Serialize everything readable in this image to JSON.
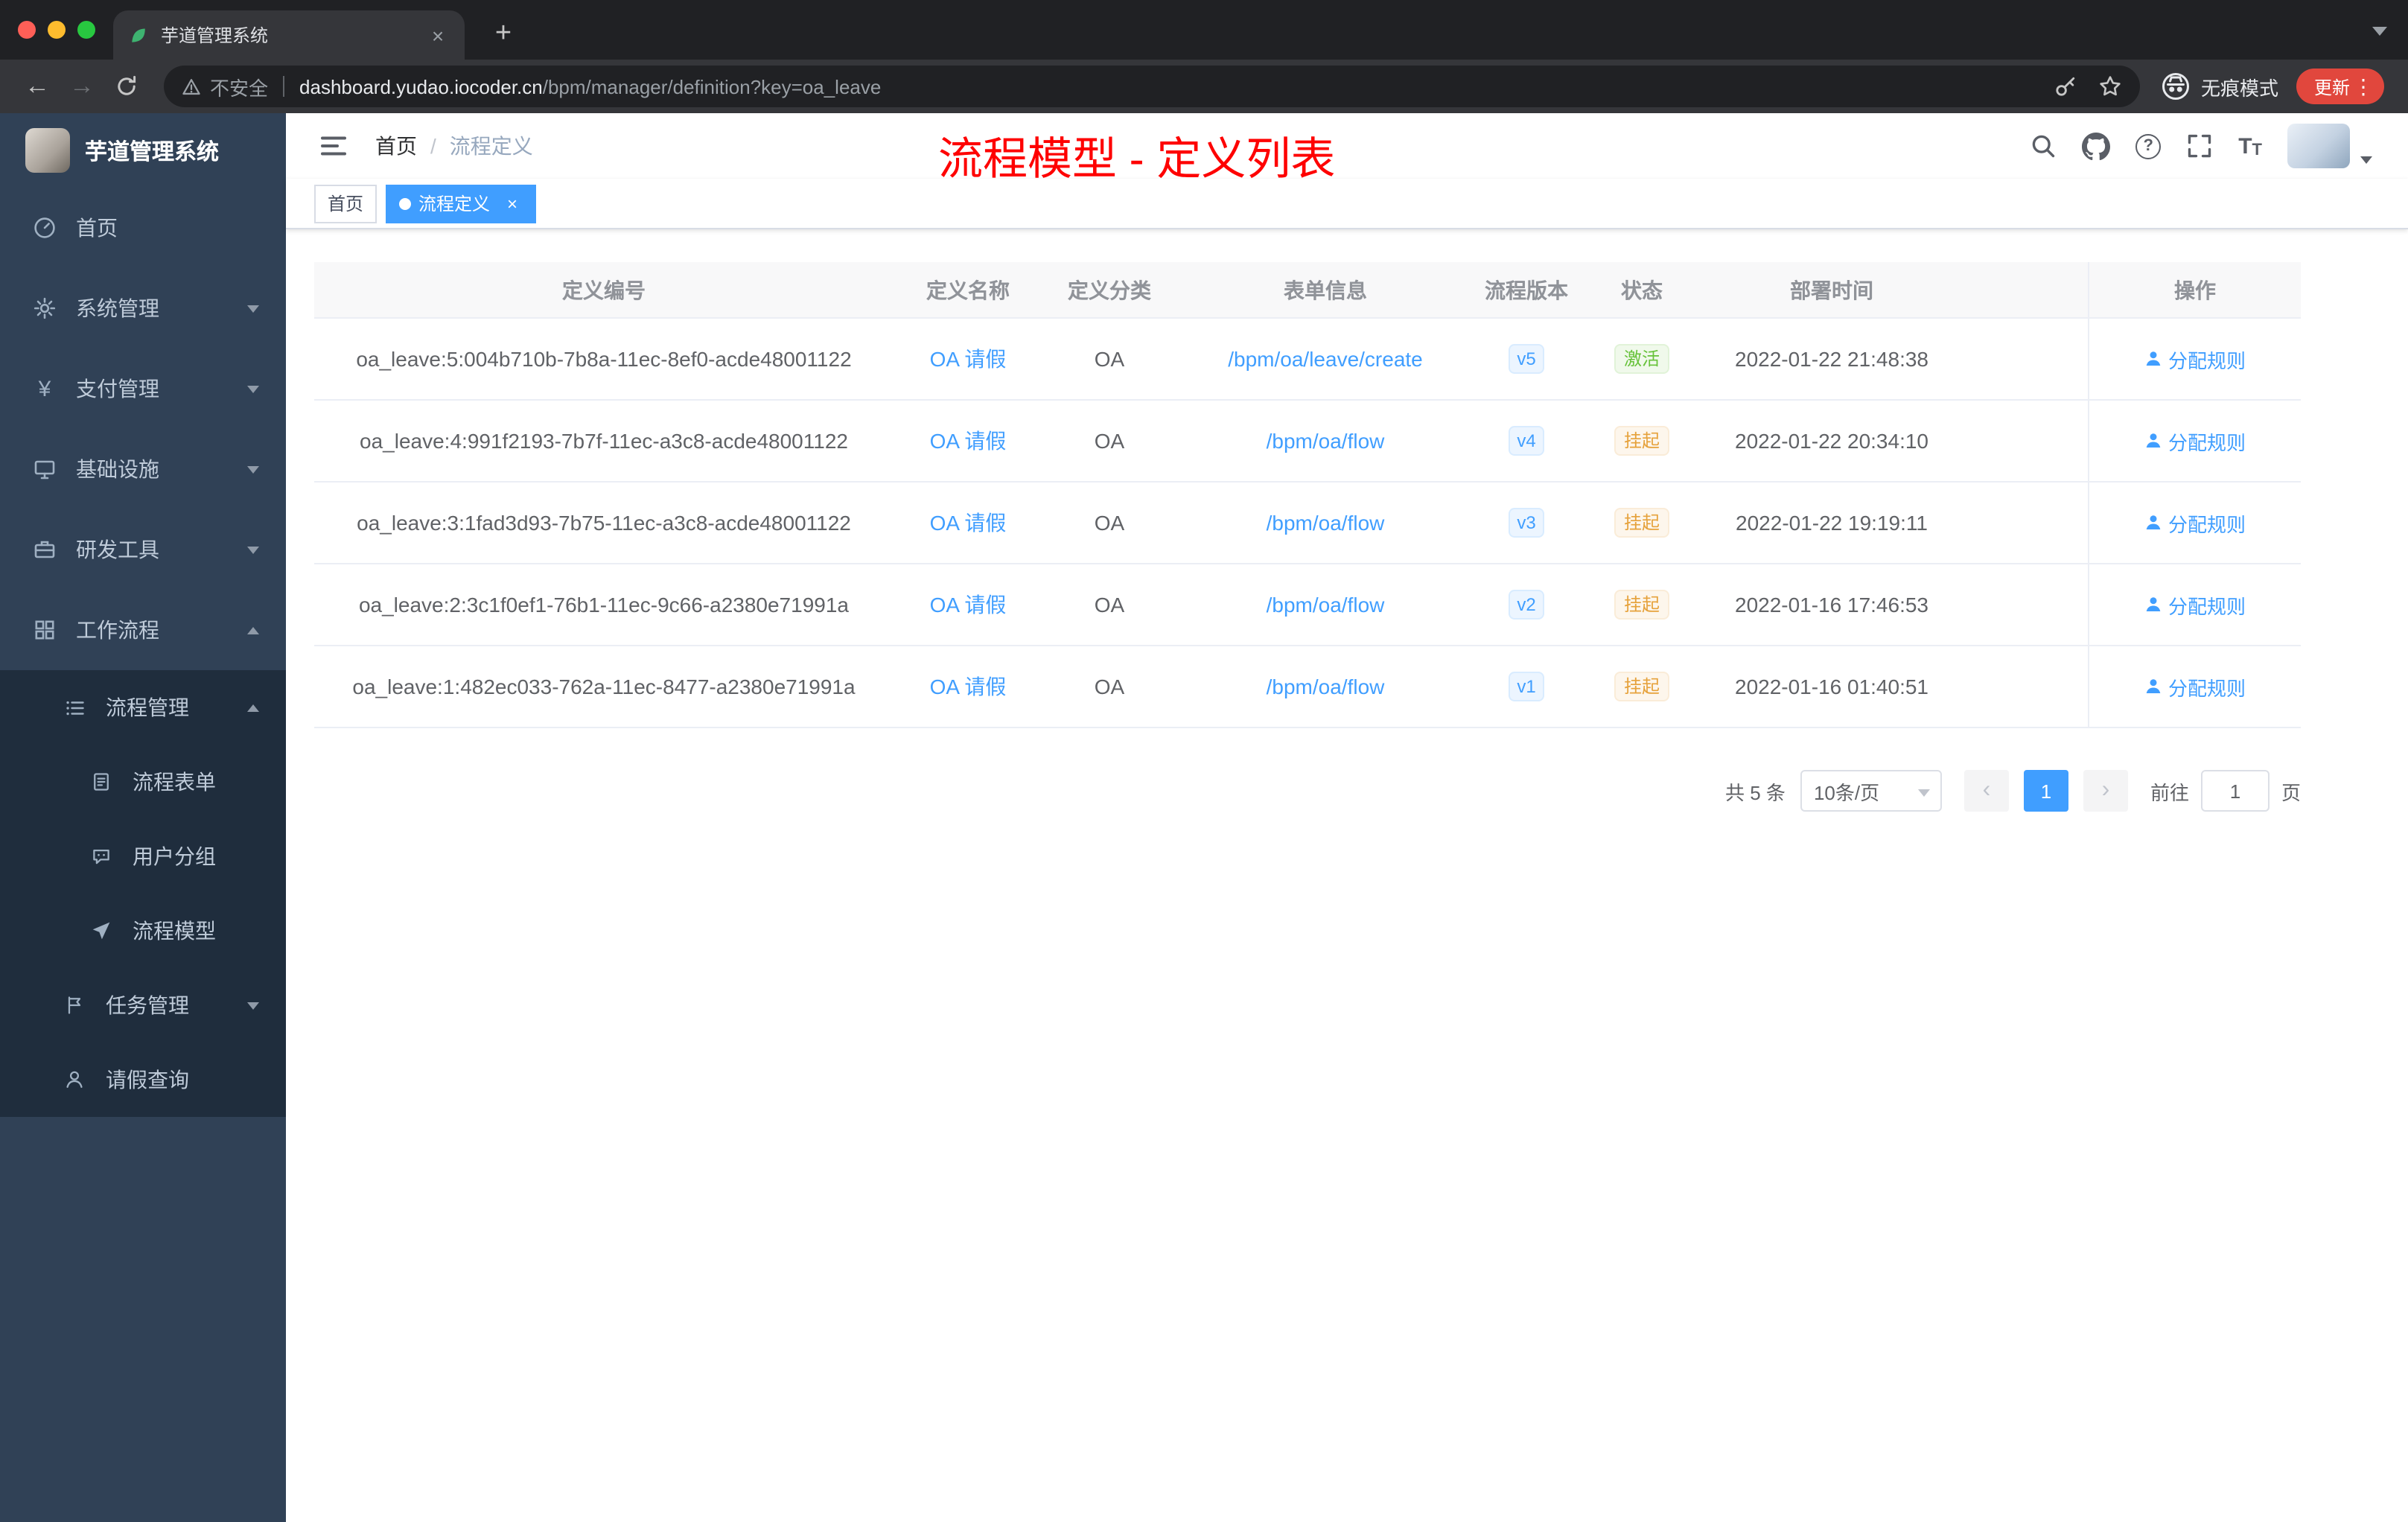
{
  "icons": {
    "close": "×",
    "plus": "+",
    "more": "⋮",
    "back": "←",
    "forward": "→",
    "prev": "‹",
    "next": "›",
    "yen": "¥",
    "question": "?",
    "t_large": "T",
    "t_small": "T"
  },
  "browser": {
    "tab_title": "芋道管理系统",
    "security_label": "不安全",
    "url_domain": "dashboard.yudao.iocoder.cn",
    "url_path": "/bpm/manager/definition?key=oa_leave",
    "incognito_label": "无痕模式",
    "update_label": "更新"
  },
  "sidebar": {
    "logo_title": "芋道管理系统",
    "items": [
      {
        "label": "首页"
      },
      {
        "label": "系统管理"
      },
      {
        "label": "支付管理"
      },
      {
        "label": "基础设施"
      },
      {
        "label": "研发工具"
      },
      {
        "label": "工作流程"
      },
      {
        "label": "流程管理"
      },
      {
        "label": "流程表单"
      },
      {
        "label": "用户分组"
      },
      {
        "label": "流程模型"
      },
      {
        "label": "任务管理"
      },
      {
        "label": "请假查询"
      }
    ]
  },
  "header": {
    "breadcrumb_home": "首页",
    "breadcrumb_sep": "/",
    "breadcrumb_current": "流程定义",
    "annotation": "流程模型 - 定义列表"
  },
  "tags": {
    "home": "首页",
    "current": "流程定义"
  },
  "table": {
    "columns": [
      "定义编号",
      "定义名称",
      "定义分类",
      "表单信息",
      "流程版本",
      "状态",
      "部署时间",
      "操作"
    ],
    "rows": [
      {
        "id": "oa_leave:5:004b710b-7b8a-11ec-8ef0-acde48001122",
        "name": "OA 请假",
        "category": "OA",
        "form": "/bpm/oa/leave/create",
        "version": "v5",
        "status": "激活",
        "time": "2022-01-22 21:48:38",
        "action": "分配规则"
      },
      {
        "id": "oa_leave:4:991f2193-7b7f-11ec-a3c8-acde48001122",
        "name": "OA 请假",
        "category": "OA",
        "form": "/bpm/oa/flow",
        "version": "v4",
        "status": "挂起",
        "time": "2022-01-22 20:34:10",
        "action": "分配规则"
      },
      {
        "id": "oa_leave:3:1fad3d93-7b75-11ec-a3c8-acde48001122",
        "name": "OA 请假",
        "category": "OA",
        "form": "/bpm/oa/flow",
        "version": "v3",
        "status": "挂起",
        "time": "2022-01-22 19:19:11",
        "action": "分配规则"
      },
      {
        "id": "oa_leave:2:3c1f0ef1-76b1-11ec-9c66-a2380e71991a",
        "name": "OA 请假",
        "category": "OA",
        "form": "/bpm/oa/flow",
        "version": "v2",
        "status": "挂起",
        "time": "2022-01-16 17:46:53",
        "action": "分配规则"
      },
      {
        "id": "oa_leave:1:482ec033-762a-11ec-8477-a2380e71991a",
        "name": "OA 请假",
        "category": "OA",
        "form": "/bpm/oa/flow",
        "version": "v1",
        "status": "挂起",
        "time": "2022-01-16 01:40:51",
        "action": "分配规则"
      }
    ]
  },
  "pagination": {
    "total": "共 5 条",
    "page_size": "10条/页",
    "page": "1",
    "goto_label": "前往",
    "page_unit": "页"
  }
}
